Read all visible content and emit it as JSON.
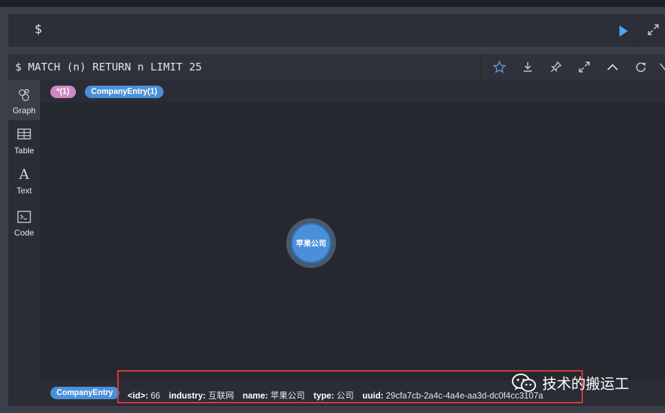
{
  "editor": {
    "prompt": "$"
  },
  "frame": {
    "query": "$ MATCH (n) RETURN n LIMIT 25",
    "tools": [
      "star-icon",
      "download-icon",
      "pin-icon",
      "fullscreen-icon",
      "collapse-icon",
      "refresh-icon"
    ]
  },
  "sidebar": {
    "items": [
      {
        "label": "Graph",
        "icon": "graph-icon",
        "active": true
      },
      {
        "label": "Table",
        "icon": "table-icon"
      },
      {
        "label": "Text",
        "icon": "text-icon"
      },
      {
        "label": "Code",
        "icon": "code-icon"
      }
    ]
  },
  "legend": {
    "all": "*(1)",
    "company": "CompanyEntry(1)"
  },
  "node": {
    "label": "苹果公司",
    "color": "#4a90d9"
  },
  "status": {
    "label": "CompanyEntry",
    "props": [
      {
        "key": "<id>:",
        "value": "66"
      },
      {
        "key": "industry:",
        "value": "互联网"
      },
      {
        "key": "name:",
        "value": "苹果公司"
      },
      {
        "key": "type:",
        "value": "公司"
      },
      {
        "key": "uuid:",
        "value": "29cfa7cb-2a4c-4a4e-aa3d-dc0f4cc3107a"
      }
    ]
  },
  "watermark": {
    "text": "技术的搬运工"
  },
  "colors": {
    "accent": "#4a90d9",
    "label_pink": "#d087c4",
    "highlight": "#e0373b"
  }
}
